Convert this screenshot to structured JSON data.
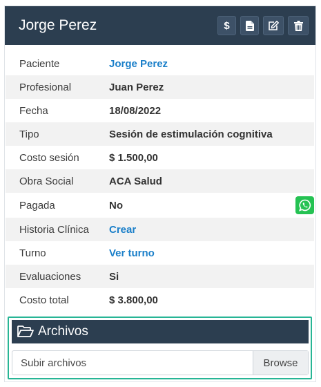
{
  "header": {
    "title": "Jorge Perez",
    "buttons": [
      {
        "icon": "dollar-icon",
        "text": "$"
      },
      {
        "icon": "document-icon"
      },
      {
        "icon": "edit-icon"
      },
      {
        "icon": "trash-icon"
      }
    ]
  },
  "details": {
    "paciente": {
      "label": "Paciente",
      "value": "Jorge Perez"
    },
    "profesional": {
      "label": "Profesional",
      "value": "Juan Perez"
    },
    "fecha": {
      "label": "Fecha",
      "value": "18/08/2022"
    },
    "tipo": {
      "label": "Tipo",
      "value": "Sesión de estimulación cognitiva"
    },
    "costo_sesion": {
      "label": "Costo sesión",
      "value": "$ 1.500,00"
    },
    "obra_social": {
      "label": "Obra Social",
      "value": "ACA Salud"
    },
    "pagada": {
      "label": "Pagada",
      "value": "No"
    },
    "historia": {
      "label": "Historia Clínica",
      "value": "Crear"
    },
    "turno": {
      "label": "Turno",
      "value": "Ver turno"
    },
    "evaluaciones": {
      "label": "Evaluaciones",
      "value": "Si"
    },
    "costo_total": {
      "label": "Costo total",
      "value": "$ 3.800,00"
    }
  },
  "archivos": {
    "title": "Archivos",
    "upload_placeholder": "Subir archivos",
    "browse_label": "Browse"
  },
  "colors": {
    "header_bg": "#2c3e50",
    "link": "#1a7fc9",
    "whatsapp": "#25c253",
    "highlight_border": "#27b595"
  }
}
